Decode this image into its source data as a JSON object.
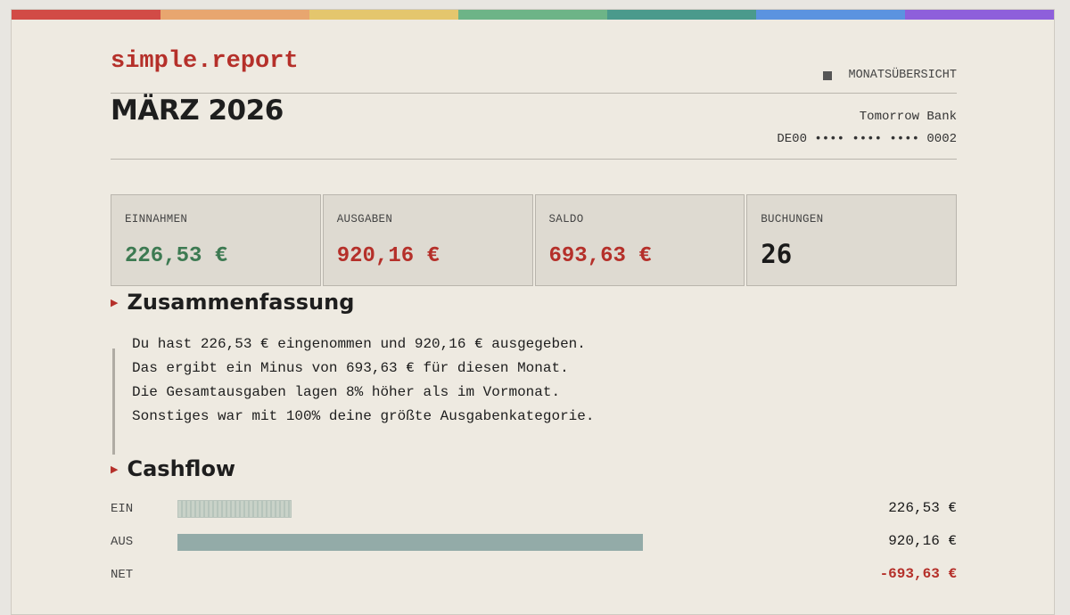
{
  "colors": {
    "rainbow": [
      "#d24b46",
      "#e8a66f",
      "#e4c66d",
      "#6db487",
      "#4a9a8c",
      "#5b93e0",
      "#8e5fdb"
    ],
    "accent": "#b5302a",
    "positive": "#3d7a52"
  },
  "header": {
    "brand": "simple.report",
    "doc_type": "MONATSÜBERSICHT",
    "month": "MÄRZ 2026",
    "bank": "Tomorrow Bank",
    "iban": "DE00 •••• •••• •••• 0002"
  },
  "kpis": {
    "income": {
      "label": "EINNAHMEN",
      "value": "226,53 €"
    },
    "expenses": {
      "label": "AUSGABEN",
      "value": "920,16 €"
    },
    "balance": {
      "label": "SALDO",
      "value": "693,63 €"
    },
    "bookings": {
      "label": "BUCHUNGEN",
      "value": "26"
    }
  },
  "summary": {
    "title": "Zusammenfassung",
    "lines": [
      "Du hast 226,53 € eingenommen und 920,16 € ausgegeben.",
      "Das ergibt ein Minus von 693,63 € für diesen Monat.",
      "Die Gesamtausgaben lagen 8% höher als im Vormonat.",
      "Sonstiges war mit 100% deine größte Ausgabenkategorie."
    ]
  },
  "cashflow": {
    "title": "Cashflow",
    "rows": [
      {
        "label": "EIN",
        "amount": "226,53 €"
      },
      {
        "label": "AUS",
        "amount": "920,16 €"
      },
      {
        "label": "NET",
        "amount": "-693,63 €"
      }
    ]
  }
}
